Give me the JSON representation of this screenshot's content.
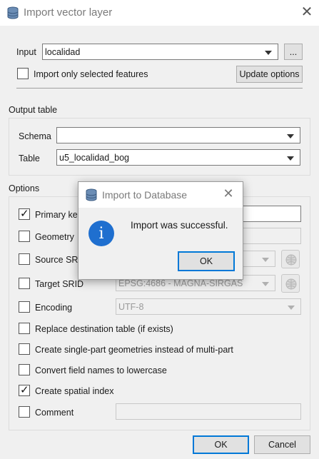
{
  "window": {
    "title": "Import vector layer",
    "close_glyph": "✕",
    "icon": "database-icon"
  },
  "input": {
    "label": "Input",
    "value": "localidad",
    "browse_label": "...",
    "only_selected_label": "Import only selected features",
    "update_options_label": "Update options"
  },
  "output_table": {
    "section_label": "Output table",
    "schema_label": "Schema",
    "schema_value": "",
    "table_label": "Table",
    "table_value": "u5_localidad_bog"
  },
  "options": {
    "section_label": "Options",
    "primary_key_label": "Primary key",
    "geometry_label": "Geometry",
    "source_srid_label": "Source SRID",
    "target_srid_label": "Target SRID",
    "target_srid_value": "EPSG:4686 - MAGNA-SIRGAS",
    "encoding_label": "Encoding",
    "encoding_value": "UTF-8",
    "replace_label": "Replace destination table (if exists)",
    "single_part_label": "Create single-part geometries instead of multi-part",
    "lowercase_label": "Convert field names to lowercase",
    "spatial_index_label": "Create spatial index",
    "comment_label": "Comment",
    "checked": {
      "primary_key": true,
      "geometry": false,
      "source_srid": false,
      "target_srid": false,
      "encoding": false,
      "replace": false,
      "single_part": false,
      "lowercase": false,
      "spatial_index": true,
      "comment": false
    }
  },
  "footer": {
    "ok_label": "OK",
    "cancel_label": "Cancel"
  },
  "modal": {
    "title": "Import to Database",
    "close_glyph": "✕",
    "icon_glyph": "i",
    "message": "Import was successful.",
    "ok_label": "OK"
  },
  "colors": {
    "accent": "#0078d7",
    "info_icon": "#1f6fcf"
  }
}
